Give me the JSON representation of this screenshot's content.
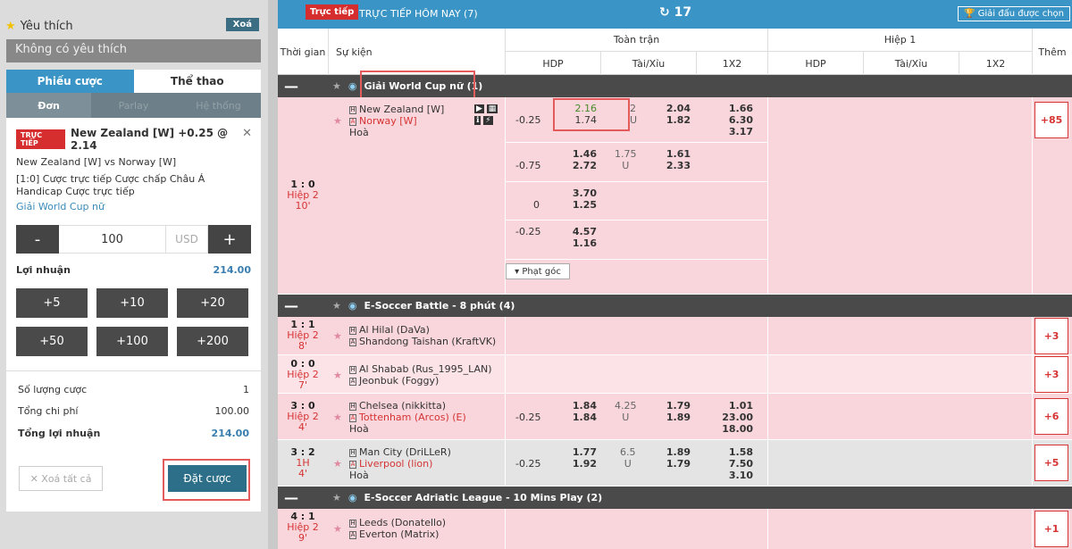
{
  "sidebar": {
    "favorites_title": "Yêu thích",
    "clear_fav": "Xoá",
    "no_favorites": "Không có yêu thích",
    "tabs": [
      {
        "label": "Phiếu cược"
      },
      {
        "label": "Thể thao"
      }
    ],
    "subtabs": [
      {
        "label": "Đơn"
      },
      {
        "label": "Parlay"
      },
      {
        "label": "Hệ thống"
      }
    ],
    "bet": {
      "live_badge": "TRỰC TIẾP",
      "selection": "New Zealand [W] +0.25 @ 2.14",
      "match": "New Zealand [W] vs Norway [W]",
      "desc": "[1:0] Cược trực tiếp Cược chấp Châu Á Handicap Cược trực tiếp",
      "league": "Giải World Cup nữ"
    },
    "stake": {
      "minus": "-",
      "amount": "100",
      "currency": "USD",
      "plus": "+"
    },
    "profit_label": "Lợi nhuận",
    "profit_value": "214.00",
    "quick_amounts": [
      "+5",
      "+10",
      "+20",
      "+50",
      "+100",
      "+200"
    ],
    "summary": {
      "count_label": "Số lượng cược",
      "count_value": "1",
      "cost_label": "Tổng chi phí",
      "cost_value": "100.00",
      "total_label": "Tổng lợi nhuận",
      "total_value": "214.00"
    },
    "clear_all": "Xoá tất cả",
    "place_bet": "Đặt cược"
  },
  "topbar": {
    "live": "Trực tiếp",
    "title": "TRỰC TIẾP HÔM NAY (7)",
    "refresh": "17",
    "fav": "Giải đấu được chọn"
  },
  "header": {
    "time": "Thời gian",
    "event": "Sự kiện",
    "full": "Toàn trận",
    "half": "Hiệp 1",
    "hdp": "HDP",
    "ou": "Tài/Xỉu",
    "x12": "1X2",
    "more": "Thêm"
  },
  "leagues": [
    {
      "name": "Giải World Cup nữ (1)"
    },
    {
      "name": "E-Soccer Battle - 8 phút (4)"
    },
    {
      "name": "E-Soccer Adriatic League - 10 Mins Play (2)"
    }
  ],
  "matches": {
    "m1": {
      "score": "1 : 0",
      "period": "Hiệp 2",
      "minute": "10'",
      "home": "New Zealand [W]",
      "away": "Norway [W]",
      "draw": "Hoà",
      "more": "+85",
      "lines": [
        {
          "hdp": "-0.25",
          "h1": "2.16",
          "h2": "1.74",
          "ou": "2",
          "ou_u": "U",
          "o1": "2.04",
          "o2": "1.82",
          "x1": "1.66",
          "x2": "6.30",
          "x3": "3.17"
        },
        {
          "hdp": "-0.75",
          "h1": "1.46",
          "h2": "2.72",
          "ou": "1.75",
          "ou_u": "U",
          "o1": "1.61",
          "o2": "2.33"
        },
        {
          "hdp": "0",
          "h1": "3.70",
          "h2": "1.25"
        },
        {
          "hdp": "-0.25",
          "h1": "4.57",
          "h2": "1.16"
        }
      ],
      "corner": "Phạt góc"
    },
    "m2": {
      "score": "1 : 1",
      "period": "Hiệp 2",
      "minute": "8'",
      "home": "Al Hilal (DaVa)",
      "away": "Shandong Taishan (KraftVK)",
      "more": "+3"
    },
    "m3": {
      "score": "0 : 0",
      "period": "Hiệp 2",
      "minute": "7'",
      "home": "Al Shabab (Rus_1995_LAN)",
      "away": "Jeonbuk (Foggy)",
      "more": "+3"
    },
    "m4": {
      "score": "3 : 0",
      "period": "Hiệp 2",
      "minute": "4'",
      "home": "Chelsea (nikkitta)",
      "away": "Tottenham (Arcos) (E)",
      "draw": "Hoà",
      "more": "+6",
      "hdp": "-0.25",
      "h1": "1.84",
      "h2": "1.84",
      "ou": "4.25",
      "ou_u": "U",
      "o1": "1.79",
      "o2": "1.89",
      "x1": "1.01",
      "x2": "23.00",
      "x3": "18.00"
    },
    "m5": {
      "score": "3 : 2",
      "period": "1H",
      "minute": "4'",
      "home": "Man City (DriLLeR)",
      "away": "Liverpool (lion)",
      "draw": "Hoà",
      "more": "+5",
      "hdp": "-0.25",
      "h1": "1.77",
      "h2": "1.92",
      "ou": "6.5",
      "ou_u": "U",
      "o1": "1.89",
      "o2": "1.79",
      "x1": "1.58",
      "x2": "7.50",
      "x3": "3.10"
    },
    "m6": {
      "score": "4 : 1",
      "period": "Hiệp 2",
      "minute": "9'",
      "home": "Leeds (Donatello)",
      "away": "Everton (Matrix)",
      "more": "+1"
    }
  },
  "colors": {
    "accent": "#3a95c6",
    "live": "#d62e2e",
    "row_pink": "#f9d6dc",
    "league_bar": "#4a4a4a"
  },
  "icons": [
    "star-icon",
    "globe-icon",
    "refresh-icon",
    "trophy-icon",
    "close-icon",
    "chevron-down-icon",
    "video-icon",
    "stats-icon"
  ]
}
